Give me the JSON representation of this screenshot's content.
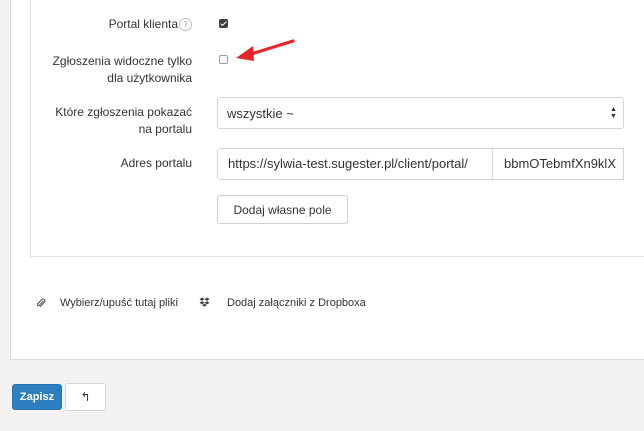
{
  "form": {
    "portal_label": "Portal klienta",
    "help_icon_glyph": "?",
    "portal_checked": true,
    "visible_only_label_line1": "Zgłoszenia widoczne tylko",
    "visible_only_label_line2": "dla użytkownika",
    "visible_only_checked": false,
    "which_label_line1": "Które zgłoszenia pokazać",
    "which_label_line2": "na portalu",
    "which_select_value": "wszystkie ~",
    "address_label": "Adres portalu",
    "address_prefix": "https://sylwia-test.sugester.pl/client/portal/",
    "address_token": "bbmOTebmfXn9klX",
    "add_field_button": "Dodaj własne pole"
  },
  "attachments": {
    "upload_label": "Wybierz/upuść tutaj pliki",
    "upload_icon": "paperclip-icon",
    "dropbox_label": "Dodaj załączniki z Dropboxa",
    "dropbox_icon": "dropbox-icon"
  },
  "actions": {
    "save_button": "Zapisz",
    "back_glyph": "↰",
    "back_icon": "return-arrow-icon"
  },
  "colors": {
    "primary": "#2d7fc0",
    "annotation_arrow": "#e8262a",
    "background": "#f2f2f2"
  }
}
